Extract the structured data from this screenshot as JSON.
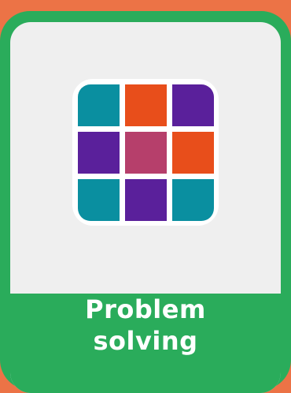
{
  "card": {
    "title_line1": "Problem",
    "title_line2": "solving"
  },
  "icon": {
    "name": "puzzle-grid-icon",
    "tile_colors": [
      "#0a8fa0",
      "#e84e1b",
      "#5a209b",
      "#5a209b",
      "#b63f6b",
      "#e84e1b",
      "#0a8fa0",
      "#5a209b",
      "#0a8fa0"
    ]
  },
  "colors": {
    "background": "#ec7346",
    "card_border": "#2aac5b",
    "card_body": "#efefef",
    "banner": "#2aac5b",
    "text": "#ffffff"
  }
}
